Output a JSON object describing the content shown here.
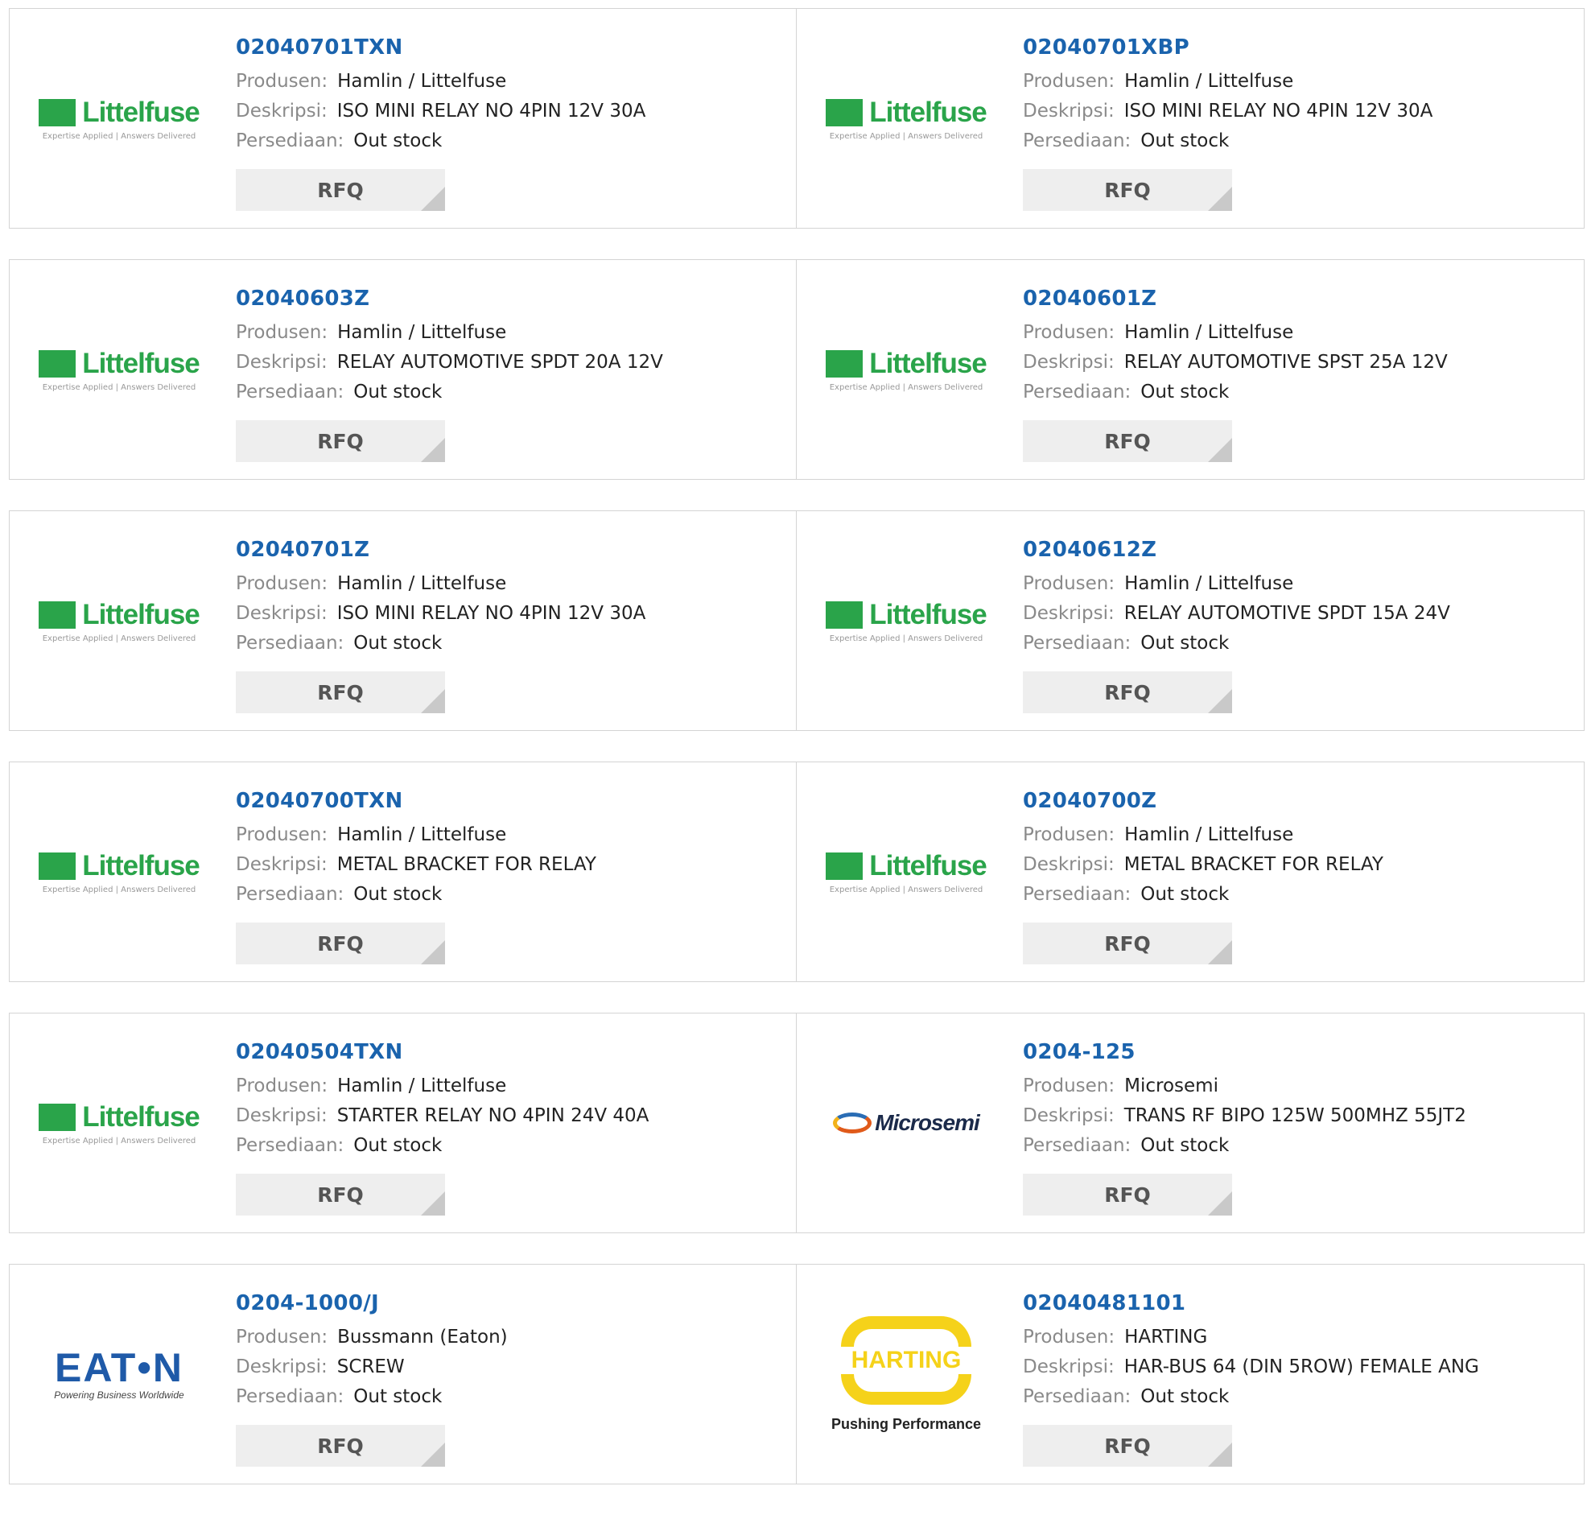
{
  "labels": {
    "manufacturer": "Produsen:",
    "description": "Deskripsi:",
    "stock": "Persediaan:",
    "rfq": "RFQ"
  },
  "brands": {
    "littelfuse": {
      "name": "Littelfuse",
      "tagline": "Expertise Applied | Answers Delivered",
      "color": "#2aa44a"
    },
    "microsemi": {
      "name": "Microsemi"
    },
    "eaton": {
      "name": "EAT•N",
      "tagline": "Powering Business Worldwide",
      "color": "#1f5aa8"
    },
    "harting": {
      "name": "HARTING",
      "tagline": "Pushing Performance",
      "color": "#f5d21a"
    }
  },
  "products": [
    {
      "part": "02040701TXN",
      "manufacturer": "Hamlin / Littelfuse",
      "description": "ISO MINI RELAY NO 4PIN 12V 30A",
      "stock": "Out stock",
      "logo": "littelfuse"
    },
    {
      "part": "02040701XBP",
      "manufacturer": "Hamlin / Littelfuse",
      "description": "ISO MINI RELAY NO 4PIN 12V 30A",
      "stock": "Out stock",
      "logo": "littelfuse"
    },
    {
      "part": "02040603Z",
      "manufacturer": "Hamlin / Littelfuse",
      "description": "RELAY AUTOMOTIVE SPDT 20A 12V",
      "stock": "Out stock",
      "logo": "littelfuse"
    },
    {
      "part": "02040601Z",
      "manufacturer": "Hamlin / Littelfuse",
      "description": "RELAY AUTOMOTIVE SPST 25A 12V",
      "stock": "Out stock",
      "logo": "littelfuse"
    },
    {
      "part": "02040701Z",
      "manufacturer": "Hamlin / Littelfuse",
      "description": "ISO MINI RELAY NO 4PIN 12V 30A",
      "stock": "Out stock",
      "logo": "littelfuse"
    },
    {
      "part": "02040612Z",
      "manufacturer": "Hamlin / Littelfuse",
      "description": "RELAY AUTOMOTIVE SPDT 15A 24V",
      "stock": "Out stock",
      "logo": "littelfuse"
    },
    {
      "part": "02040700TXN",
      "manufacturer": "Hamlin / Littelfuse",
      "description": "METAL BRACKET FOR RELAY",
      "stock": "Out stock",
      "logo": "littelfuse"
    },
    {
      "part": "02040700Z",
      "manufacturer": "Hamlin / Littelfuse",
      "description": "METAL BRACKET FOR RELAY",
      "stock": "Out stock",
      "logo": "littelfuse"
    },
    {
      "part": "02040504TXN",
      "manufacturer": "Hamlin / Littelfuse",
      "description": "STARTER RELAY NO 4PIN 24V 40A",
      "stock": "Out stock",
      "logo": "littelfuse"
    },
    {
      "part": "0204-125",
      "manufacturer": "Microsemi",
      "description": "TRANS RF BIPO 125W 500MHZ 55JT2",
      "stock": "Out stock",
      "logo": "microsemi"
    },
    {
      "part": "0204-1000/J",
      "manufacturer": "Bussmann (Eaton)",
      "description": "SCREW",
      "stock": "Out stock",
      "logo": "eaton"
    },
    {
      "part": "02040481101",
      "manufacturer": "HARTING",
      "description": "HAR-BUS 64 (DIN 5ROW) FEMALE ANG",
      "stock": "Out stock",
      "logo": "harting"
    }
  ]
}
